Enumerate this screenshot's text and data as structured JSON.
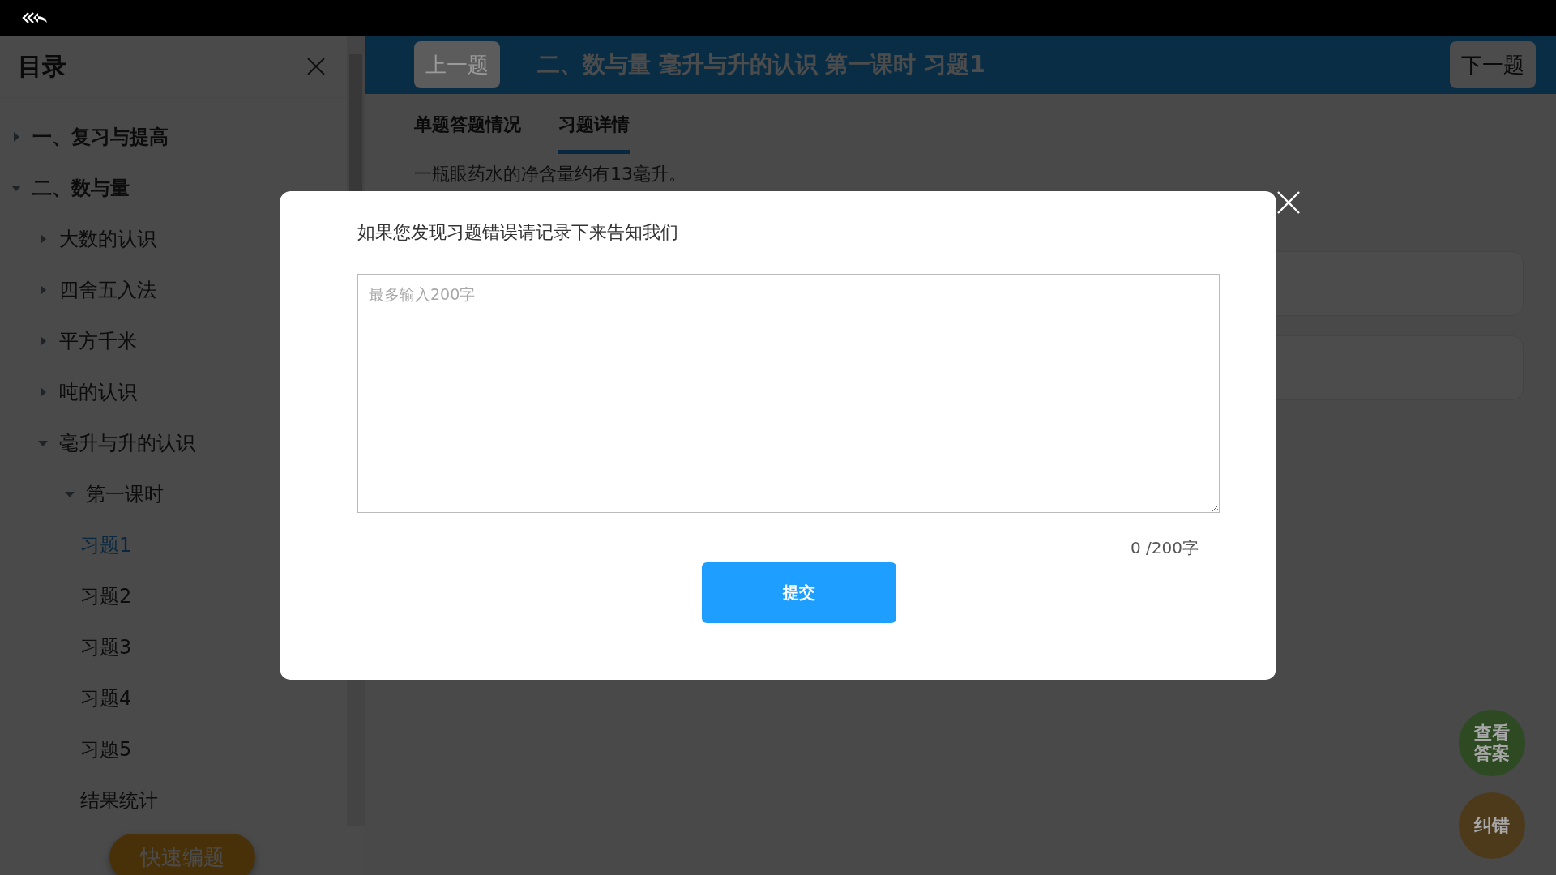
{
  "sidebar": {
    "title": "目录",
    "tree": [
      {
        "kind": "folder",
        "label": "一、复习与提高",
        "expanded": false,
        "selected": false
      },
      {
        "kind": "folder",
        "label": "二、数与量",
        "expanded": true,
        "selected": false,
        "children": [
          {
            "kind": "folder",
            "label": "大数的认识",
            "expanded": false,
            "selected": false
          },
          {
            "kind": "folder",
            "label": "四舍五入法",
            "expanded": false,
            "selected": false
          },
          {
            "kind": "folder",
            "label": "平方千米",
            "expanded": false,
            "selected": false
          },
          {
            "kind": "folder",
            "label": "吨的认识",
            "expanded": false,
            "selected": false
          },
          {
            "kind": "folder",
            "label": "毫升与升的认识",
            "expanded": true,
            "selected": false,
            "children": [
              {
                "kind": "folder",
                "label": "第一课时",
                "expanded": true,
                "selected": false,
                "children": [
                  {
                    "kind": "leaf",
                    "label": "习题1",
                    "selected": true
                  },
                  {
                    "kind": "leaf",
                    "label": "习题2",
                    "selected": false
                  },
                  {
                    "kind": "leaf",
                    "label": "习题3",
                    "selected": false
                  },
                  {
                    "kind": "leaf",
                    "label": "习题4",
                    "selected": false
                  },
                  {
                    "kind": "leaf",
                    "label": "习题5",
                    "selected": false
                  },
                  {
                    "kind": "leaf",
                    "label": "结果统计",
                    "selected": false
                  }
                ]
              }
            ]
          }
        ]
      }
    ],
    "quick_edit_button": "快速编题"
  },
  "header": {
    "prev_button": {
      "label": "上一题",
      "disabled": true
    },
    "title": "二、数与量 毫升与升的认识 第一课时 习题1",
    "next_button": {
      "label": "下一题",
      "disabled": false
    }
  },
  "tabs": [
    {
      "label": "单题答题情况",
      "selected": false
    },
    {
      "label": "习题详情",
      "selected": true
    }
  ],
  "question": {
    "text": "一瓶眼药水的净含量约有13毫升。"
  },
  "float_buttons": [
    {
      "label": "查看答案",
      "color": "#2d4a22"
    },
    {
      "label": "纠错",
      "color": "#4d3a1a"
    }
  ],
  "modal": {
    "title": "如果您发现习题错误请记录下来告知我们",
    "placeholder": "最多输入200字",
    "counter": "0 /200字",
    "submit": "提交"
  }
}
